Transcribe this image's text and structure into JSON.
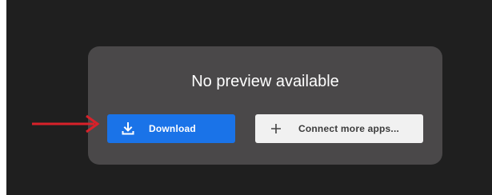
{
  "preview": {
    "message": "No preview available"
  },
  "actions": {
    "download_label": "Download",
    "download_icon": "download-icon",
    "connect_label": "Connect more apps...",
    "connect_icon": "plus-icon"
  },
  "annotation": {
    "arrow_color": "#d8212a",
    "arrow_icon": "red-arrow-pointing-right"
  },
  "colors": {
    "viewer_background": "#1f1f1f",
    "dialog_background": "#4a4849",
    "primary_button": "#1a73e8",
    "secondary_button": "#f1f1f1"
  }
}
